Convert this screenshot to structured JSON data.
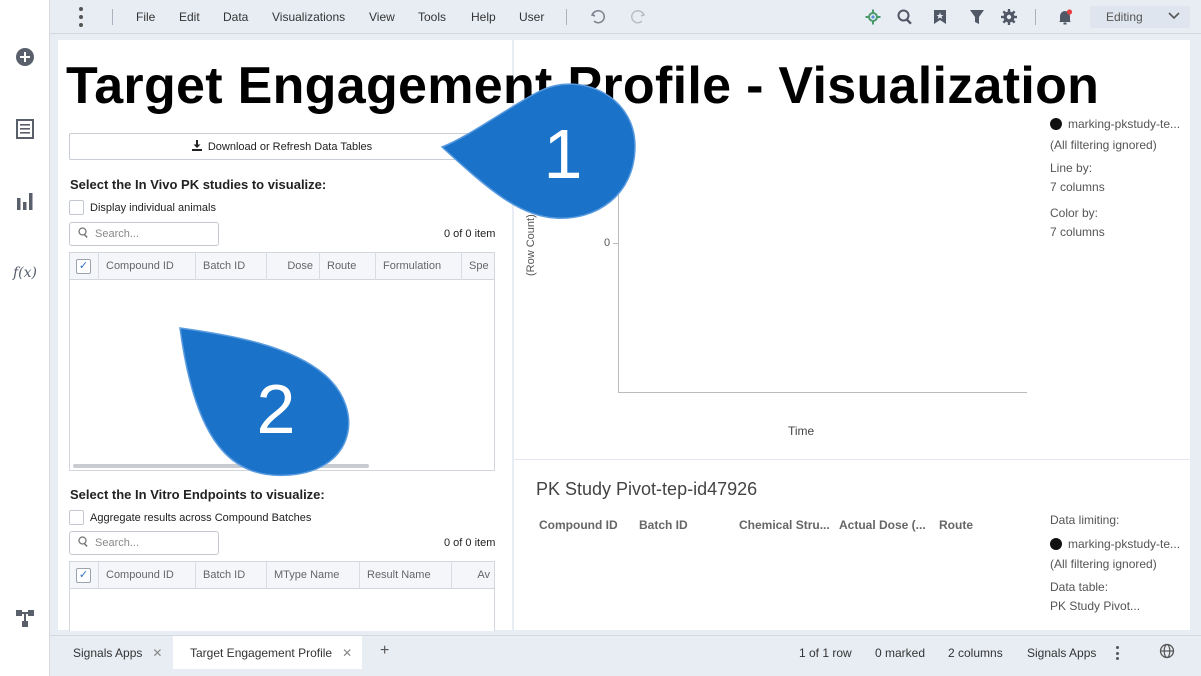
{
  "menubar": {
    "items": [
      "File",
      "Edit",
      "Data",
      "Visualizations",
      "View",
      "Tools",
      "Help",
      "User"
    ],
    "mode": "Editing"
  },
  "page": {
    "title": "Target Engagement Profile - Visualization",
    "download_button": "Download or Refresh Data Tables"
  },
  "pk_section": {
    "label": "Select the In Vivo PK studies to visualize:",
    "checkbox_label": "Display individual animals",
    "search_placeholder": "Search...",
    "count": "0 of 0 item",
    "columns": [
      "Compound ID",
      "Batch ID",
      "Dose",
      "Route",
      "Formulation",
      "Spe"
    ]
  },
  "invitro_section": {
    "label": "Select the In Vitro Endpoints to visualize:",
    "checkbox_label": "Aggregate results across Compound Batches",
    "search_placeholder": "Search...",
    "count": "0 of 0 item",
    "columns": [
      "Compound ID",
      "Batch ID",
      "MType Name",
      "Result Name",
      "Av"
    ]
  },
  "chart": {
    "y_label": "(Row Count)",
    "y_tick": "0",
    "x_label": "Time",
    "legend_dot_color": "#111111",
    "legend": {
      "marking": "marking-pkstudy-te...",
      "filtering": "(All filtering ignored)",
      "line_by_label": "Line by:",
      "line_by_value": "7 columns",
      "color_by_label": "Color by:",
      "color_by_value": "7 columns"
    }
  },
  "pivot_table": {
    "title": "PK Study Pivot-tep-id47926",
    "columns": [
      "Compound ID",
      "Batch ID",
      "Chemical Stru...",
      "Actual Dose (...",
      "Route"
    ],
    "side": {
      "data_limiting_label": "Data limiting:",
      "marking": "marking-pkstudy-te...",
      "filtering": "(All filtering ignored)",
      "data_table_label": "Data table:",
      "data_table_value": "PK Study Pivot..."
    }
  },
  "callouts": {
    "one": "1",
    "two": "2",
    "color": "#1a73c8"
  },
  "statusbar": {
    "tabs": [
      "Signals Apps",
      "Target Engagement Profile"
    ],
    "add_tab": "+",
    "rows": "1 of 1 row",
    "marked": "0 marked",
    "columns": "2 columns",
    "app": "Signals Apps"
  }
}
